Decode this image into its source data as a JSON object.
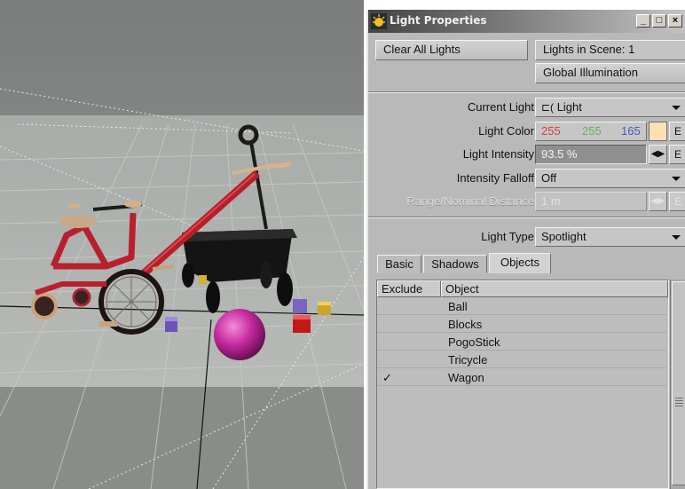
{
  "window": {
    "title": "Light Properties",
    "minimize": "_",
    "maximize": "□",
    "close": "×"
  },
  "toolbar": {
    "clear_all_lights": "Clear All Lights",
    "lights_in_scene": "Lights in Scene: 1",
    "global_illumination": "Global Illumination"
  },
  "properties": {
    "current_light_label": "Current Light",
    "current_light_value": "Light",
    "current_light_icon": "spot-light-icon",
    "light_color_label": "Light Color",
    "light_color": {
      "r": "255",
      "g": "255",
      "b": "165",
      "swatch": "#ffffa5"
    },
    "light_intensity_label": "Light Intensity",
    "light_intensity_value": "93.5 %",
    "intensity_falloff_label": "Intensity Falloff",
    "intensity_falloff_value": "Off",
    "range_label": "Range/Nominal Distance",
    "range_value": "1 m",
    "envelope_button": "E",
    "light_type_label": "Light Type",
    "light_type_value": "Spotlight"
  },
  "tabs": [
    {
      "label": "Basic",
      "active": false
    },
    {
      "label": "Shadows",
      "active": false
    },
    {
      "label": "Objects",
      "active": true
    }
  ],
  "object_list": {
    "columns": [
      "Exclude",
      "Object"
    ],
    "rows": [
      {
        "exclude": "",
        "object": "Ball"
      },
      {
        "exclude": "",
        "object": "Blocks"
      },
      {
        "exclude": "",
        "object": "PogoStick"
      },
      {
        "exclude": "",
        "object": "Tricycle"
      },
      {
        "exclude": "✓",
        "object": "Wagon"
      }
    ]
  },
  "colors": {
    "panel_bg": "#b9b9b9",
    "red_channel": "#d84040",
    "green_channel": "#5aa85a",
    "blue_channel": "#3f5fb8"
  }
}
